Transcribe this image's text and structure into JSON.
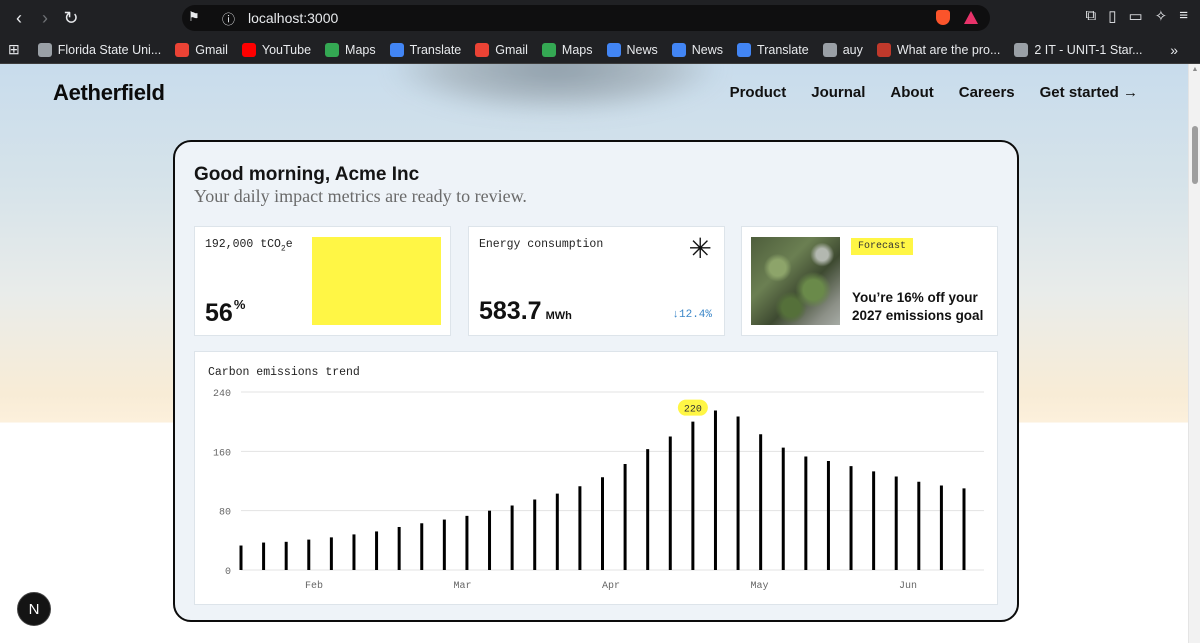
{
  "browser": {
    "url": "localhost:3000",
    "bookmarks": [
      {
        "label": "Florida State Uni...",
        "color": "#9aa0a6"
      },
      {
        "label": "Gmail",
        "color": "#ea4335"
      },
      {
        "label": "YouTube",
        "color": "#ff0000"
      },
      {
        "label": "Maps",
        "color": "#34a853"
      },
      {
        "label": "Translate",
        "color": "#4285f4"
      },
      {
        "label": "Gmail",
        "color": "#ea4335"
      },
      {
        "label": "Maps",
        "color": "#34a853"
      },
      {
        "label": "News",
        "color": "#4285f4"
      },
      {
        "label": "News",
        "color": "#4285f4"
      },
      {
        "label": "Translate",
        "color": "#4285f4"
      },
      {
        "label": "auy",
        "color": "#9aa0a6"
      },
      {
        "label": "What are the pro...",
        "color": "#c0392b"
      },
      {
        "label": "2 IT - UNIT-1 Star...",
        "color": "#9aa0a6"
      }
    ]
  },
  "site": {
    "logo": "Aetherfield",
    "nav": [
      "Product",
      "Journal",
      "About",
      "Careers",
      "Get started →"
    ]
  },
  "dashboard": {
    "greeting": "Good morning, Acme Inc",
    "subtitle": "Your daily impact metrics are ready to review.",
    "tile1": {
      "label_pre": "192,000 tCO",
      "label_sub": "2",
      "label_post": "e",
      "value": "56",
      "unit": "%",
      "accent": "#fff645"
    },
    "tile2": {
      "label": "Energy consumption",
      "value": "583.7",
      "unit": "MWh",
      "delta": "↓12.4%",
      "icon": "asterisk-icon"
    },
    "tile3": {
      "badge": "Forecast",
      "text": "You’re 16% off your 2027 emissions goal"
    }
  },
  "chart_data": {
    "type": "bar",
    "title": "Carbon emissions trend",
    "ylim": [
      0,
      240
    ],
    "yticks": [
      0,
      80,
      160,
      240
    ],
    "xticks": [
      "Feb",
      "Mar",
      "Apr",
      "May",
      "Jun"
    ],
    "highlight": {
      "label": "220",
      "index": 20
    },
    "values": [
      33,
      37,
      38,
      41,
      44,
      48,
      52,
      58,
      63,
      68,
      73,
      80,
      87,
      95,
      103,
      113,
      125,
      143,
      163,
      180,
      200,
      215,
      207,
      183,
      165,
      153,
      147,
      140,
      133,
      126,
      119,
      114,
      110
    ],
    "grid": true
  }
}
